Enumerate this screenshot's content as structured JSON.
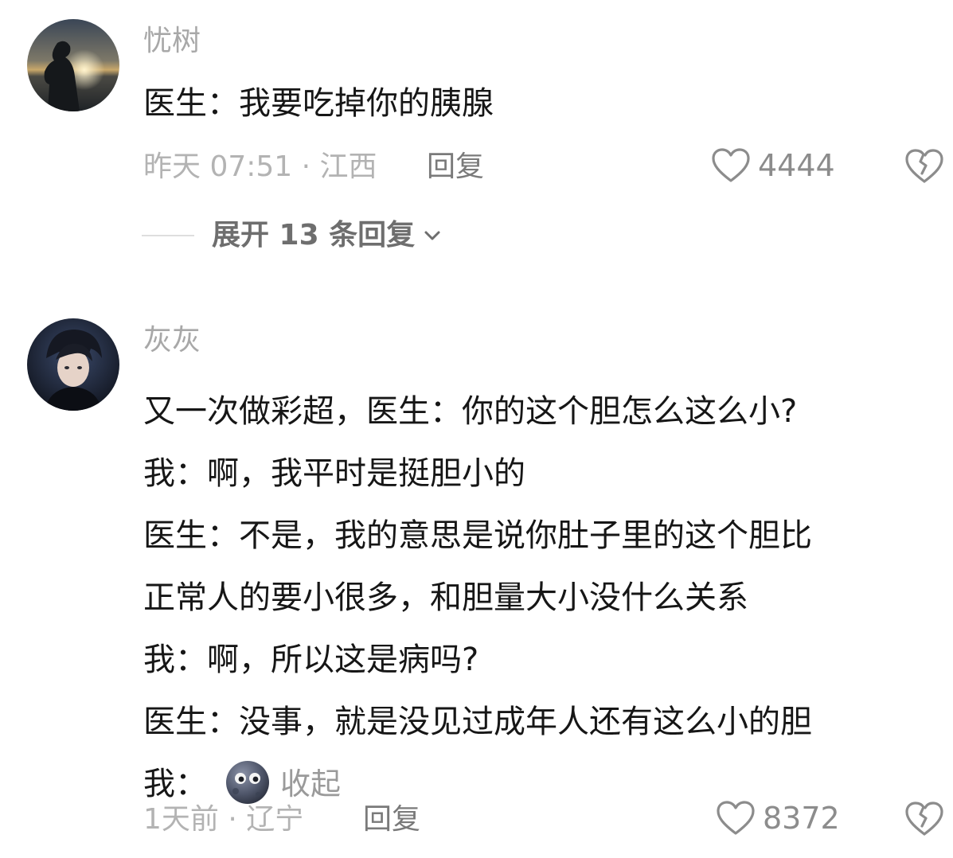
{
  "comments": [
    {
      "username": "忧树",
      "lines": [
        "医生：我要吃掉你的胰腺"
      ],
      "meta": "昨天 07:51 · 江西",
      "reply_label": "回复",
      "likes": "4444",
      "expand_label": "展开 13 条回复",
      "avatar_icon": "sunset-silhouette-avatar"
    },
    {
      "username": "灰灰",
      "lines": [
        "又一次做彩超，医生：你的这个胆怎么这么小?",
        "我：啊，我平时是挺胆小的",
        "医生：不是，我的意思是说你肚子里的这个胆比",
        "正常人的要小很多，和胆量大小没什么关系",
        "我：啊，所以这是病吗?",
        "医生：没事，就是没见过成年人还有这么小的胆"
      ],
      "last_line_prefix": "我：",
      "last_line_emoji": "moon-face-emoji",
      "collapse_label": "收起",
      "meta": "1天前 · 辽宁",
      "reply_label": "回复",
      "likes": "8372",
      "avatar_icon": "anime-boy-avatar"
    }
  ],
  "icons": {
    "like": "heart-outline-icon",
    "dislike": "broken-heart-icon",
    "expand": "chevron-down-icon"
  },
  "colors": {
    "username": "#a8a8a8",
    "body": "#161616",
    "meta": "#b3b3b3",
    "reply": "#7a7a7a",
    "like": "#8c8c8c"
  }
}
